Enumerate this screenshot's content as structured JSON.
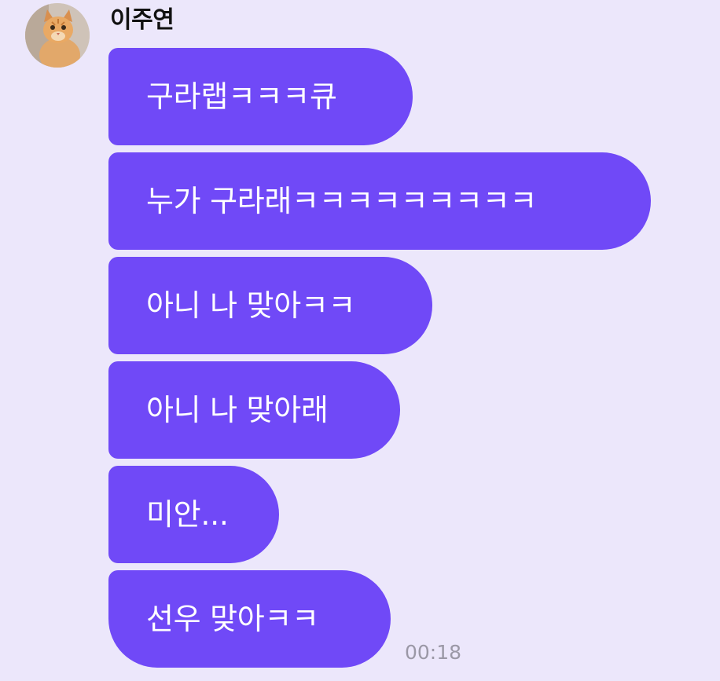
{
  "sender": {
    "name": "이주연",
    "avatar_icon": "cat-avatar-icon"
  },
  "messages": [
    {
      "text": "구라랩ㅋㅋㅋ큐"
    },
    {
      "text": "누가 구라래ㅋㅋㅋㅋㅋㅋㅋㅋㅋ"
    },
    {
      "text": "아니 나 맞아ㅋㅋ"
    },
    {
      "text": "아니 나 맞아래"
    },
    {
      "text": "미안..."
    },
    {
      "text": "선우 맞아ㅋㅋ"
    }
  ],
  "timestamp": "00:18",
  "colors": {
    "background": "#ece7fb",
    "bubble": "#7049f7",
    "bubble_text": "#ffffff",
    "timestamp": "#9b98a6"
  }
}
